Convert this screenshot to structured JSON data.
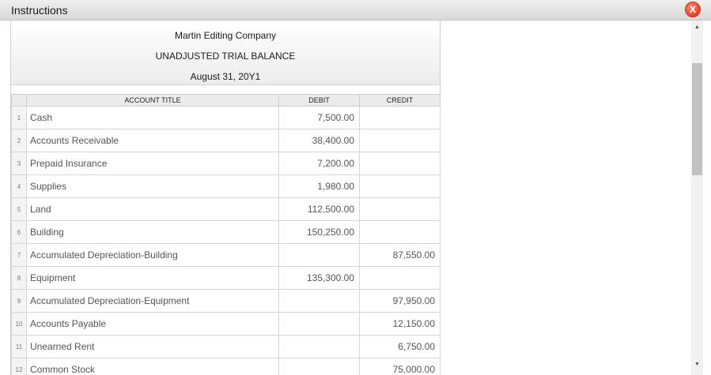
{
  "window": {
    "title": "Instructions",
    "close_label": "X"
  },
  "report": {
    "company": "Martin Editing Company",
    "title": "UNADJUSTED TRIAL BALANCE",
    "date": "August 31, 20Y1"
  },
  "columns": {
    "account": "ACCOUNT TITLE",
    "debit": "DEBIT",
    "credit": "CREDIT"
  },
  "rows": [
    {
      "num": "1",
      "account": "Cash",
      "debit": "7,500.00",
      "credit": ""
    },
    {
      "num": "2",
      "account": "Accounts Receivable",
      "debit": "38,400.00",
      "credit": ""
    },
    {
      "num": "3",
      "account": "Prepaid Insurance",
      "debit": "7,200.00",
      "credit": ""
    },
    {
      "num": "4",
      "account": "Supplies",
      "debit": "1,980.00",
      "credit": ""
    },
    {
      "num": "5",
      "account": "Land",
      "debit": "112,500.00",
      "credit": ""
    },
    {
      "num": "6",
      "account": "Building",
      "debit": "150,250.00",
      "credit": ""
    },
    {
      "num": "7",
      "account": "Accumulated Depreciation-Building",
      "debit": "",
      "credit": "87,550.00"
    },
    {
      "num": "8",
      "account": "Equipment",
      "debit": "135,300.00",
      "credit": ""
    },
    {
      "num": "9",
      "account": "Accumulated Depreciation-Equipment",
      "debit": "",
      "credit": "97,950.00"
    },
    {
      "num": "10",
      "account": "Accounts Payable",
      "debit": "",
      "credit": "12,150.00"
    },
    {
      "num": "11",
      "account": "Unearned Rent",
      "debit": "",
      "credit": "6,750.00"
    },
    {
      "num": "12",
      "account": "Common Stock",
      "debit": "",
      "credit": "75,000.00"
    }
  ],
  "scrollbar": {
    "up_icon": "triangle-up-icon",
    "down_icon": "triangle-down-icon",
    "position_fraction": 0.12
  }
}
